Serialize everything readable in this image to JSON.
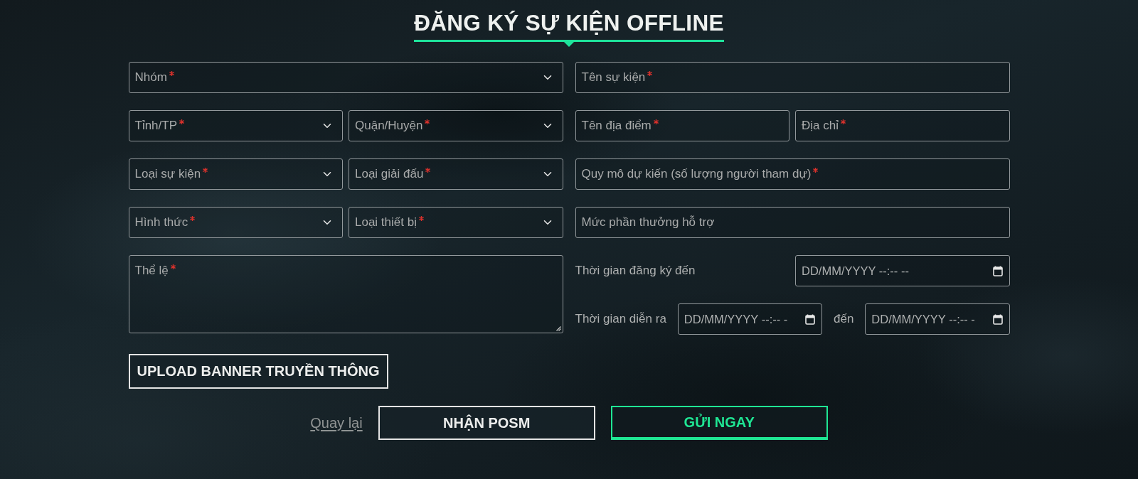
{
  "title": "ĐĂNG KÝ SỰ KIỆN OFFLINE",
  "left_rows": [
    [
      {
        "kind": "select",
        "placeholder": "Nhóm",
        "required": true
      }
    ],
    [
      {
        "kind": "select",
        "placeholder": "Tỉnh/TP",
        "required": true
      },
      {
        "kind": "select",
        "placeholder": "Quận/Huyện",
        "required": true
      }
    ],
    [
      {
        "kind": "select",
        "placeholder": "Loại sự kiện",
        "required": true
      },
      {
        "kind": "select",
        "placeholder": "Loại giải đấu",
        "required": true
      }
    ],
    [
      {
        "kind": "select",
        "placeholder": "Hình thức",
        "required": true
      },
      {
        "kind": "select",
        "placeholder": "Loại thiết bị",
        "required": true
      }
    ],
    [
      {
        "kind": "textarea",
        "placeholder": "Thể lệ",
        "required": true
      }
    ]
  ],
  "right_rows": [
    [
      {
        "kind": "text",
        "placeholder": "Tên sự kiện",
        "required": true
      }
    ],
    [
      {
        "kind": "text",
        "placeholder": "Tên địa điểm",
        "required": true
      },
      {
        "kind": "text",
        "placeholder": "Địa chỉ",
        "required": true
      }
    ],
    [
      {
        "kind": "text",
        "placeholder": "Quy mô dự kiến (số lượng người tham dự)",
        "required": true
      }
    ],
    [
      {
        "kind": "text",
        "placeholder": "Mức phần thưởng hỗ trợ",
        "required": false
      }
    ]
  ],
  "schedule": [
    {
      "label": "Thời gian đăng ký đến",
      "fields": [
        {
          "placeholder": "DD/MM/YYYY --:-- --"
        }
      ]
    },
    {
      "label": "Thời gian diễn ra",
      "separator": "đến",
      "fields": [
        {
          "placeholder": "DD/MM/YYYY --:-- -"
        },
        {
          "placeholder": "DD/MM/YYYY --:-- -"
        }
      ]
    }
  ],
  "upload_button": {
    "label": "UPLOAD BANNER TRUYỀN THÔNG"
  },
  "actions": [
    {
      "kind": "link",
      "label": "Quay lại"
    },
    {
      "kind": "outline",
      "label": "NHẬN POSM"
    },
    {
      "kind": "primary",
      "label": "GỬI NGAY"
    }
  ]
}
